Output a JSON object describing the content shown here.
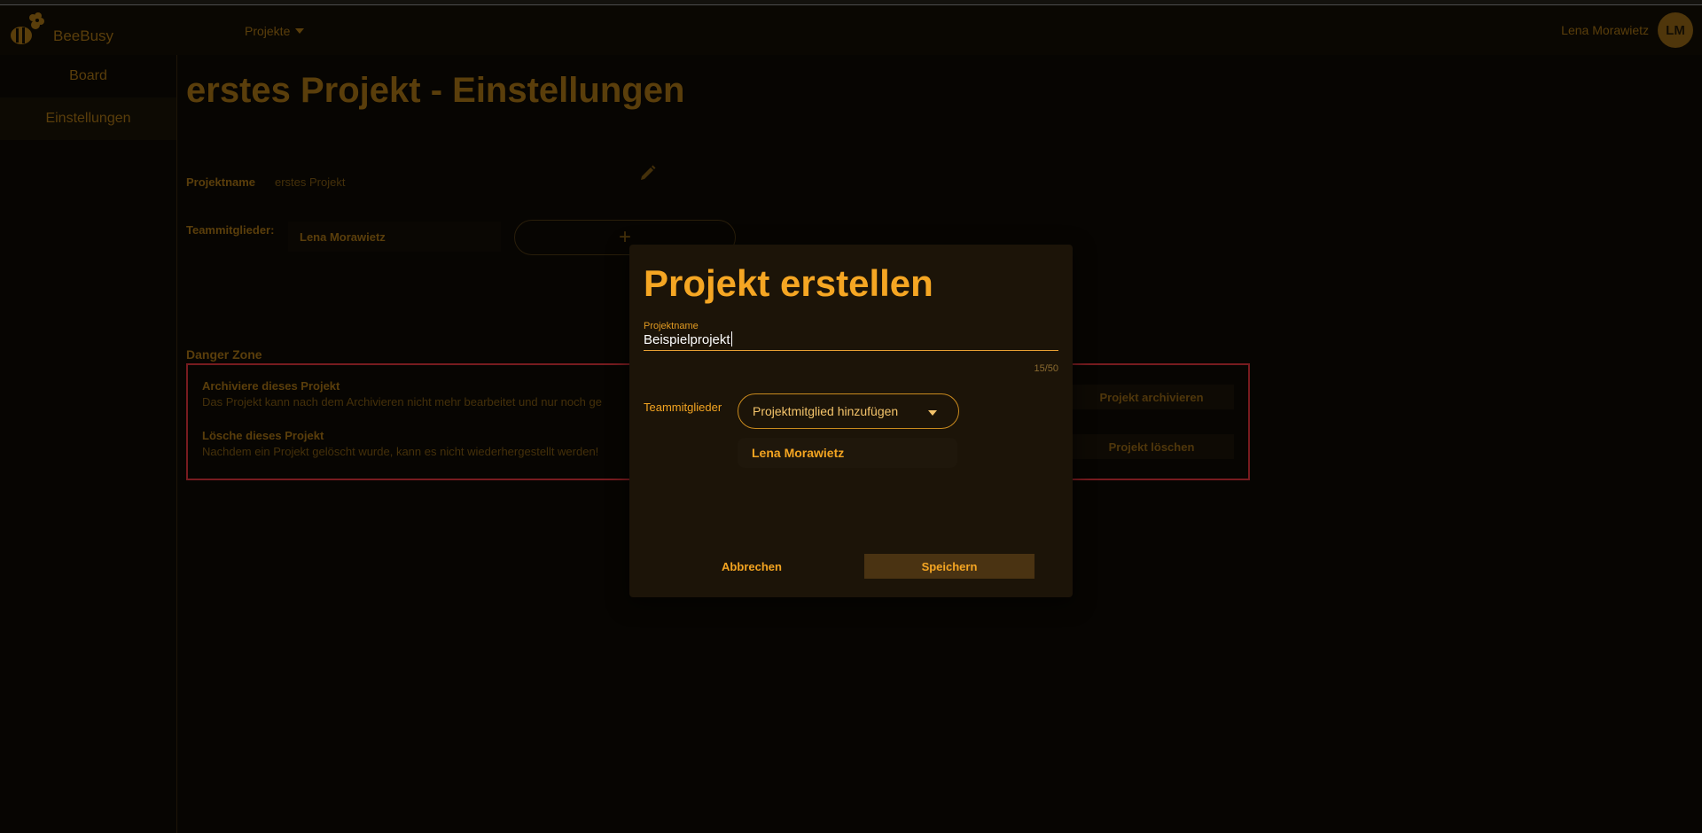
{
  "app": {
    "brand": "BeeBusy"
  },
  "navbar": {
    "menu_label": "Projekte",
    "user_name": "Lena Morawietz",
    "user_initials": "LM"
  },
  "sidebar": {
    "items": [
      {
        "label": "Board"
      },
      {
        "label": "Einstellungen"
      }
    ]
  },
  "settings": {
    "title": "erstes Projekt - Einstellungen",
    "project_name_label": "Projektname",
    "project_name_value": "erstes Projekt",
    "team_label": "Teammitglieder:",
    "team_members": [
      "Lena Morawietz"
    ],
    "add_member_symbol": "+",
    "danger_zone": {
      "title": "Danger Zone",
      "archive_title": "Archiviere dieses Projekt",
      "archive_text": "Das Projekt kann nach dem Archivieren nicht mehr bearbeitet und nur noch ge",
      "archive_button": "Projekt archivieren",
      "delete_title": "Lösche dieses Projekt",
      "delete_text": "Nachdem ein Projekt gelöscht wurde, kann es nicht wiederhergestellt werden!",
      "delete_button": "Projekt löschen"
    }
  },
  "modal": {
    "title": "Projekt erstellen",
    "name_label": "Projektname",
    "name_value": "Beispielprojekt",
    "counter": "15/50",
    "team_label": "Teammitglieder",
    "select_placeholder": "Projektmitglied hinzufügen",
    "members": [
      "Lena Morawietz"
    ],
    "cancel_label": "Abbrechen",
    "save_label": "Speichern"
  },
  "colors": {
    "accent": "#f5a623",
    "danger": "#a5262b",
    "background": "#0a0703",
    "modal_bg": "#1c1408"
  }
}
